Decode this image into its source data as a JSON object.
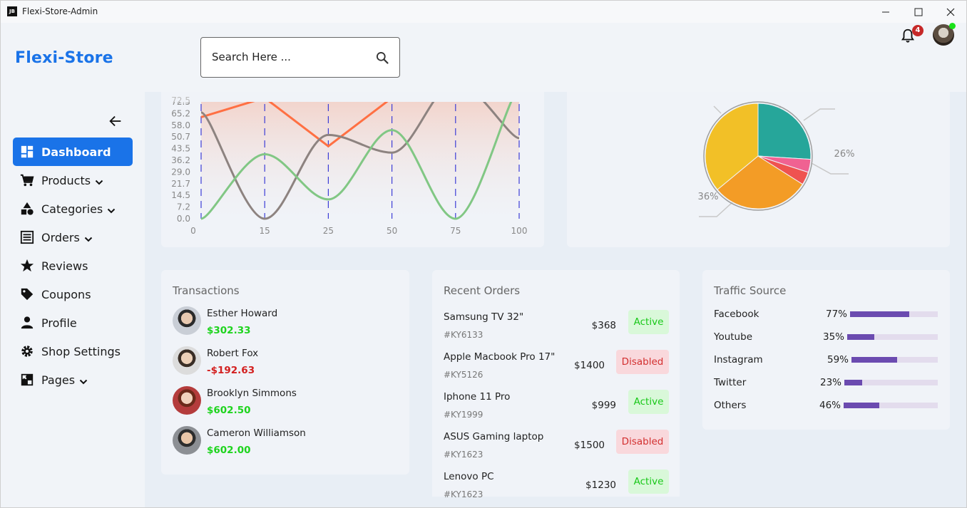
{
  "window": {
    "app_icon_text": "JB",
    "title": "Flexi-Store-Admin",
    "minimize": "—",
    "maximize": "☐",
    "close": "✕"
  },
  "header": {
    "brand": "Flexi-Store",
    "search_placeholder": "Search Here ...",
    "notification_count": "4"
  },
  "sidebar": {
    "items": [
      {
        "label": "Dashboard",
        "icon": "dashboard-icon",
        "active": true,
        "has_chevron": false
      },
      {
        "label": "Products",
        "icon": "cart-icon",
        "active": false,
        "has_chevron": true
      },
      {
        "label": "Categories",
        "icon": "shapes-icon",
        "active": false,
        "has_chevron": true
      },
      {
        "label": "Orders",
        "icon": "list-icon",
        "active": false,
        "has_chevron": true
      },
      {
        "label": "Reviews",
        "icon": "star-icon",
        "active": false,
        "has_chevron": false
      },
      {
        "label": "Coupons",
        "icon": "tag-icon",
        "active": false,
        "has_chevron": false
      },
      {
        "label": "Profile",
        "icon": "person-icon",
        "active": false,
        "has_chevron": false
      },
      {
        "label": "Shop Settings",
        "icon": "gear-icon",
        "active": false,
        "has_chevron": false
      },
      {
        "label": "Pages",
        "icon": "puzzle-icon",
        "active": false,
        "has_chevron": true
      }
    ]
  },
  "chart_data": [
    {
      "type": "line",
      "x": [
        0,
        15,
        25,
        50,
        75,
        100
      ],
      "x_tick_labels": [
        "0",
        "15",
        "25",
        "50",
        "75",
        "100"
      ],
      "y_tick_labels": [
        "0.0",
        "7.2",
        "14.5",
        "21.7",
        "29.0",
        "36.2",
        "43.5",
        "50.7",
        "58.0",
        "65.2",
        "72.5"
      ],
      "ylim": [
        0,
        72.5
      ],
      "series": [
        {
          "color": "#ff7043",
          "values": [
            63,
            75,
            45,
            75,
            90,
            80
          ]
        },
        {
          "color": "#8d8380",
          "values": [
            66,
            0,
            52,
            41,
            85,
            50
          ]
        },
        {
          "color": "#81c784",
          "values": [
            0,
            40,
            12,
            55,
            0,
            80
          ]
        }
      ],
      "vertical_marker_color": "#3d3dd6"
    },
    {
      "type": "pie",
      "slices": [
        {
          "color": "#26a69a",
          "value": 26
        },
        {
          "color": "#f06292",
          "value": 4
        },
        {
          "color": "#ef5350",
          "value": 4
        },
        {
          "color": "#f39c26",
          "value": 30
        },
        {
          "color": "#f2c027",
          "value": 36
        }
      ],
      "labels": [
        "26%",
        "36%"
      ]
    }
  ],
  "transactions": {
    "title": "Transactions",
    "items": [
      {
        "name": "Esther Howard",
        "amount": "$302.33",
        "negative": false
      },
      {
        "name": "Robert Fox",
        "amount": "-$192.63",
        "negative": true
      },
      {
        "name": "Brooklyn Simmons",
        "amount": "$602.50",
        "negative": false
      },
      {
        "name": "Cameron Williamson",
        "amount": "$602.00",
        "negative": false
      }
    ]
  },
  "orders": {
    "title": "Recent Orders",
    "items": [
      {
        "name": "Samsung TV 32\"",
        "id": "#KY6133",
        "price": "$368",
        "status": "Active"
      },
      {
        "name": "Apple Macbook Pro 17\"",
        "id": "#KY5126",
        "price": "$1400",
        "status": "Disabled"
      },
      {
        "name": "Iphone 11 Pro",
        "id": "#KY1999",
        "price": "$999",
        "status": "Active"
      },
      {
        "name": "ASUS Gaming laptop",
        "id": "#KY1623",
        "price": "$1500",
        "status": "Disabled"
      },
      {
        "name": "Lenovo PC",
        "id": "#KY1623",
        "price": "$1230",
        "status": "Active"
      }
    ]
  },
  "traffic": {
    "title": "Traffic Source",
    "items": [
      {
        "name": "Facebook",
        "percent_label": "77%",
        "value": 0.77
      },
      {
        "name": "Youtube",
        "percent_label": "35%",
        "value": 0.35
      },
      {
        "name": "Instagram",
        "percent_label": "59%",
        "value": 0.59
      },
      {
        "name": "Twitter",
        "percent_label": "23%",
        "value": 0.23
      },
      {
        "name": "Others",
        "percent_label": "46%",
        "value": 0.46
      }
    ]
  },
  "colors": {
    "accent": "#1a73e8",
    "positive": "#1ed41e",
    "negative": "#d32020",
    "traffic_bar": "#6b4bb0"
  }
}
